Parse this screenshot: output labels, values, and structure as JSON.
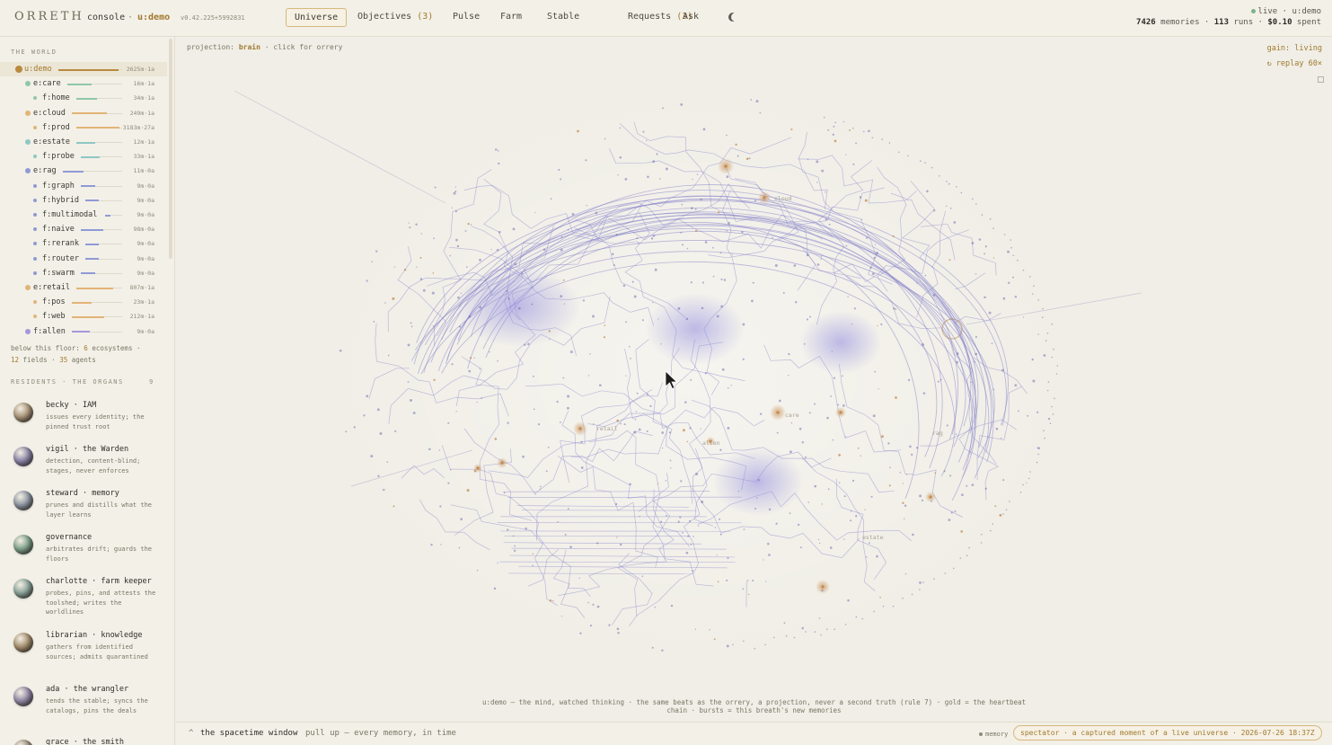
{
  "header": {
    "brand": "ORRETH",
    "console": "console",
    "separator": "·",
    "user": "u:demo",
    "version": "v0.42.225+5992831",
    "tabs": [
      {
        "label": "Universe",
        "count": ""
      },
      {
        "label": "Objectives",
        "count": "(3)"
      },
      {
        "label": "Pulse",
        "count": ""
      },
      {
        "label": "Farm",
        "count": ""
      },
      {
        "label": "Stable",
        "count": ""
      },
      {
        "label": "Requests",
        "count": "(3)"
      },
      {
        "label": "Ask",
        "count": ""
      }
    ],
    "theme_icon": "moon-icon",
    "status": {
      "live": "live · u:demo",
      "memories_count": "7426",
      "memories_label": "memories ·",
      "runs_count": "113",
      "runs_label": "runs ·",
      "spent": "$0.10",
      "spent_label": "spent"
    }
  },
  "sidebar": {
    "world_label": "THE WORLD",
    "tree": [
      {
        "name": "u:demo",
        "value": "2625m·1a",
        "color": "#b98a3e",
        "level": 0,
        "fill": 0.95
      },
      {
        "name": "e:care",
        "value": "16m·1a",
        "color": "#8fc7a7",
        "level": 1,
        "fill": 0.45
      },
      {
        "name": "f:home",
        "value": "34m·1a",
        "color": "#8fc7a7",
        "level": 2,
        "fill": 0.45
      },
      {
        "name": "e:cloud",
        "value": "249m·1a",
        "color": "#e2b477",
        "level": 1,
        "fill": 0.7
      },
      {
        "name": "f:prod",
        "value": "3183m·27a",
        "color": "#e2b477",
        "level": 2,
        "fill": 0.95
      },
      {
        "name": "e:estate",
        "value": "12m·1a",
        "color": "#8fc7c4",
        "level": 1,
        "fill": 0.4
      },
      {
        "name": "f:probe",
        "value": "33m·1a",
        "color": "#8fc7c4",
        "level": 2,
        "fill": 0.45
      },
      {
        "name": "e:rag",
        "value": "11m·0a",
        "color": "#8f9ad6",
        "level": 1,
        "fill": 0.35
      },
      {
        "name": "f:graph",
        "value": "9m·0a",
        "color": "#8f9ad6",
        "level": 2,
        "fill": 0.35
      },
      {
        "name": "f:hybrid",
        "value": "9m·0a",
        "color": "#8f9ad6",
        "level": 2,
        "fill": 0.35
      },
      {
        "name": "f:multimodal",
        "value": "9m·0a",
        "color": "#8f9ad6",
        "level": 2,
        "fill": 0.35
      },
      {
        "name": "f:naive",
        "value": "98m·0a",
        "color": "#8f9ad6",
        "level": 2,
        "fill": 0.55
      },
      {
        "name": "f:rerank",
        "value": "9m·0a",
        "color": "#8f9ad6",
        "level": 2,
        "fill": 0.35
      },
      {
        "name": "f:router",
        "value": "9m·0a",
        "color": "#8f9ad6",
        "level": 2,
        "fill": 0.35
      },
      {
        "name": "f:swarm",
        "value": "9m·0a",
        "color": "#8f9ad6",
        "level": 2,
        "fill": 0.35
      },
      {
        "name": "e:retail",
        "value": "807m·1a",
        "color": "#e2b477",
        "level": 1,
        "fill": 0.8
      },
      {
        "name": "f:pos",
        "value": "23m·1a",
        "color": "#e2b477",
        "level": 2,
        "fill": 0.4
      },
      {
        "name": "f:web",
        "value": "212m·1a",
        "color": "#e2b477",
        "level": 2,
        "fill": 0.65
      },
      {
        "name": "f:allen",
        "value": "9m·0a",
        "color": "#a597d9",
        "level": 1,
        "fill": 0.35
      }
    ],
    "floor_note_prefix": "below this floor:",
    "floor_ecosystems": "6",
    "floor_ecosystems_label": "ecosystems ·",
    "floor_fields": "12",
    "floor_fields_label": "fields ·",
    "floor_agents": "35",
    "floor_agents_label": "agents",
    "residents_label": "RESIDENTS · THE ORGANS",
    "residents_count": "9",
    "residents": [
      {
        "name": "becky · IAM",
        "desc": "issues every identity; the pinned trust root",
        "orb": "#a89478"
      },
      {
        "name": "vigil · the Warden",
        "desc": "detection, content-blind; stages, never enforces",
        "orb": "#8c85a8"
      },
      {
        "name": "steward · memory",
        "desc": "prunes and distills what the layer learns",
        "orb": "#8e96a3"
      },
      {
        "name": "governance",
        "desc": "arbitrates drift; guards the floors",
        "orb": "#7fa08c"
      },
      {
        "name": "charlotte · farm keeper",
        "desc": "probes, pins, and attests the toolshed; writes the worldlines",
        "orb": "#8aa39a"
      },
      {
        "name": "librarian · knowledge",
        "desc": "gathers from identified sources; admits quarantined",
        "orb": "#a58f6f"
      },
      {
        "name": "ada · the wrangler",
        "desc": "tends the stable; syncs the catalogs, pins the deals",
        "orb": "#9288a6"
      },
      {
        "name": "grace · the smith",
        "desc": "",
        "orb": "#9a8f7c"
      }
    ]
  },
  "main": {
    "projection_label": "projection:",
    "projection_value": "brain",
    "projection_hint": "· click for orrery",
    "gain": "gain: living",
    "replay": "↻ replay 60×",
    "expand_icon": "expand-icon",
    "regions": [
      "cloud",
      "care",
      "retail",
      "allen",
      "rag",
      "estate"
    ],
    "caption_line1": "u:demo — the mind, watched thinking · the same beats as the orrery, a projection, never a second truth (rule 7) · gold = the heartbeat",
    "caption_line2": "chain · bursts = this breath's new memories"
  },
  "bottom": {
    "caret": "^",
    "title": "the spacetime window",
    "hint": "pull up — every memory, in time",
    "memory_label": "memory",
    "spectator": "spectator · a captured moment of a live universe · 2026-07-26 18:37Z"
  },
  "colors": {
    "accent": "#a07a2e",
    "line": "#7b77c8",
    "glow": "#8f8ae0",
    "gold": "#c68b4f"
  }
}
